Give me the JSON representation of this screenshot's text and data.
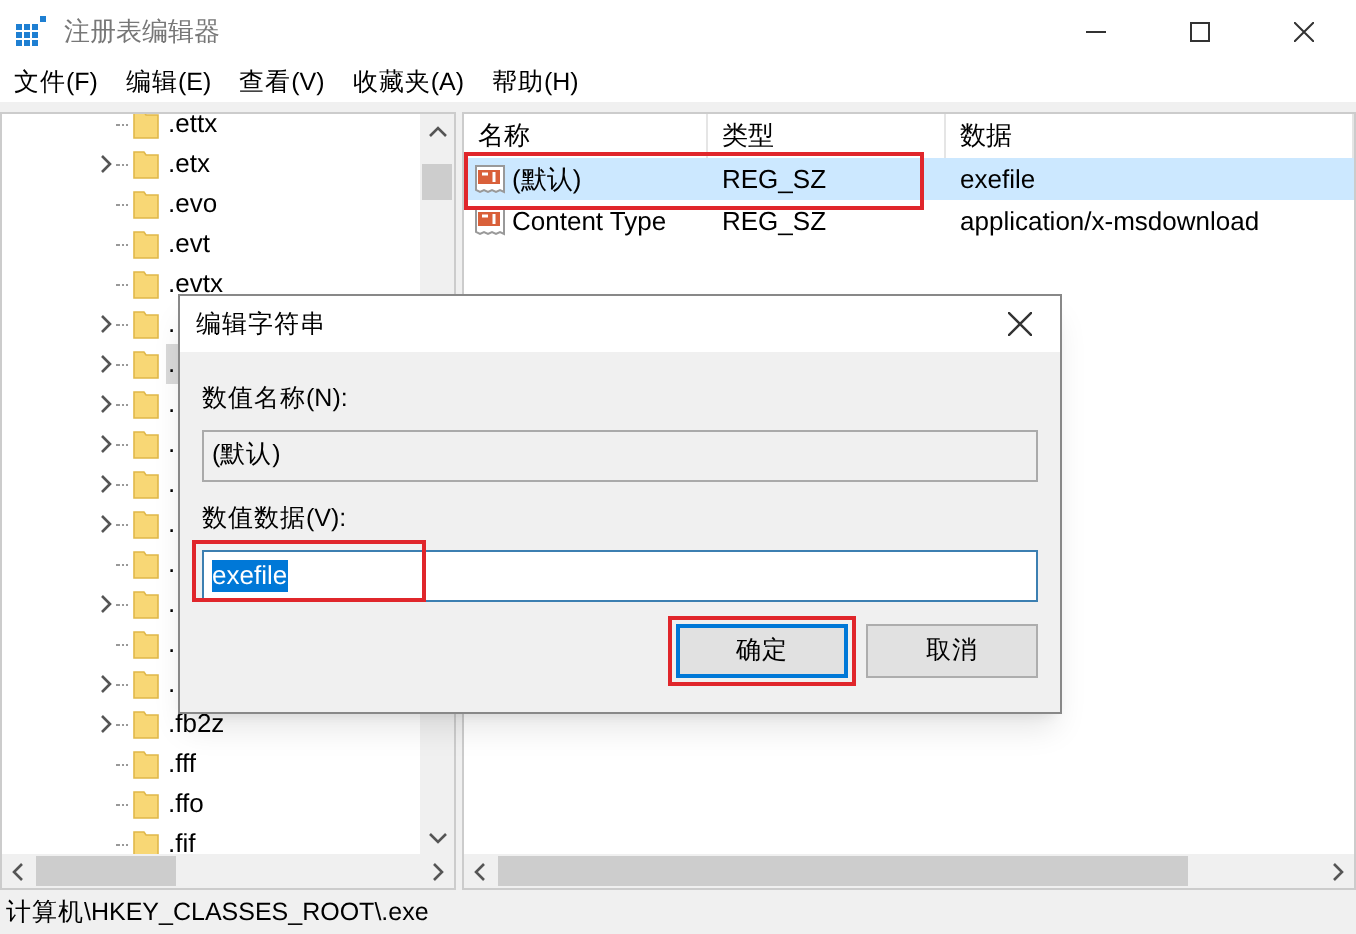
{
  "window": {
    "title": "注册表编辑器"
  },
  "menu": [
    "文件(F)",
    "编辑(E)",
    "查看(V)",
    "收藏夹(A)",
    "帮助(H)"
  ],
  "tree": [
    {
      "label": ".ettx",
      "expandable": false,
      "selected": false
    },
    {
      "label": ".etx",
      "expandable": true,
      "selected": false
    },
    {
      "label": ".evo",
      "expandable": false,
      "selected": false
    },
    {
      "label": ".evt",
      "expandable": false,
      "selected": false
    },
    {
      "label": ".evtx",
      "expandable": false,
      "selected": false
    },
    {
      "label": ".",
      "expandable": true,
      "selected": false
    },
    {
      "label": ".",
      "expandable": true,
      "selected": true
    },
    {
      "label": ".",
      "expandable": true,
      "selected": false
    },
    {
      "label": ".",
      "expandable": true,
      "selected": false
    },
    {
      "label": ".",
      "expandable": true,
      "selected": false
    },
    {
      "label": ".",
      "expandable": true,
      "selected": false
    },
    {
      "label": ".",
      "expandable": false,
      "selected": false
    },
    {
      "label": ".",
      "expandable": true,
      "selected": false
    },
    {
      "label": ".",
      "expandable": false,
      "selected": false
    },
    {
      "label": ".",
      "expandable": true,
      "selected": false
    },
    {
      "label": ".fb2z",
      "expandable": true,
      "selected": false
    },
    {
      "label": ".fff",
      "expandable": false,
      "selected": false
    },
    {
      "label": ".ffo",
      "expandable": false,
      "selected": false
    },
    {
      "label": ".fif",
      "expandable": false,
      "selected": false
    }
  ],
  "table": {
    "columns": [
      "名称",
      "类型",
      "数据"
    ],
    "rows": [
      {
        "name": "(默认)",
        "type": "REG_SZ",
        "data": "exefile",
        "selected": true,
        "highlighted": true
      },
      {
        "name": "Content Type",
        "type": "REG_SZ",
        "data": "application/x-msdownload",
        "selected": false,
        "highlighted": false
      }
    ]
  },
  "dialog": {
    "title": "编辑字符串",
    "name_label": "数值名称(N):",
    "name_value": "(默认)",
    "data_label": "数值数据(V):",
    "data_value": "exefile",
    "data_highlighted": true,
    "buttons": [
      {
        "label": "确定",
        "default": true,
        "highlighted": true
      },
      {
        "label": "取消",
        "default": false,
        "highlighted": false
      }
    ]
  },
  "status_bar": "计算机\\HKEY_CLASSES_ROOT\\.exe"
}
